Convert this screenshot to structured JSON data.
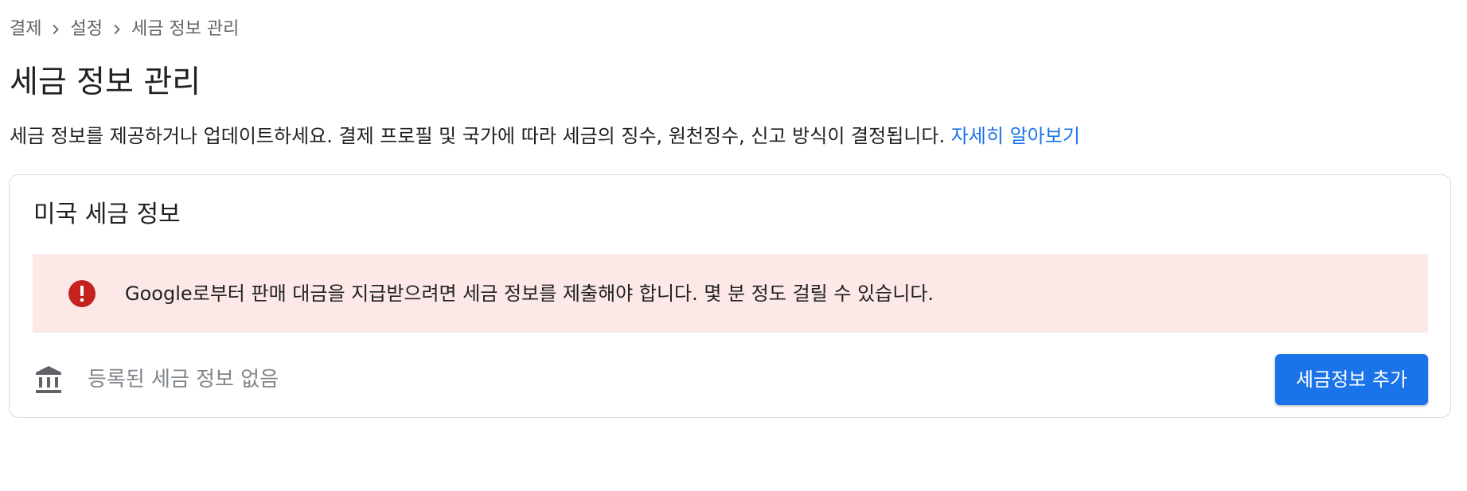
{
  "breadcrumb": {
    "items": [
      "결제",
      "설정",
      "세금 정보 관리"
    ]
  },
  "page": {
    "title": "세금 정보 관리",
    "description": "세금 정보를 제공하거나 업데이트하세요. 결제 프로필 및 국가에 따라 세금의 징수, 원천징수, 신고 방식이 결정됩니다.",
    "learn_more_label": "자세히 알아보기"
  },
  "card": {
    "title": "미국 세금 정보",
    "alert": {
      "icon": "error-icon",
      "text": "Google로부터 판매 대금을 지급받으려면 세금 정보를 제출해야 합니다. 몇 분 정도 걸릴 수 있습니다."
    },
    "tax_row": {
      "icon": "bank-icon",
      "empty_text": "등록된 세금 정보 없음",
      "add_button_label": "세금정보 추가"
    }
  },
  "colors": {
    "accent": "#1a73e8",
    "alert_background": "#fce8e6",
    "alert_icon": "#c5221f"
  }
}
